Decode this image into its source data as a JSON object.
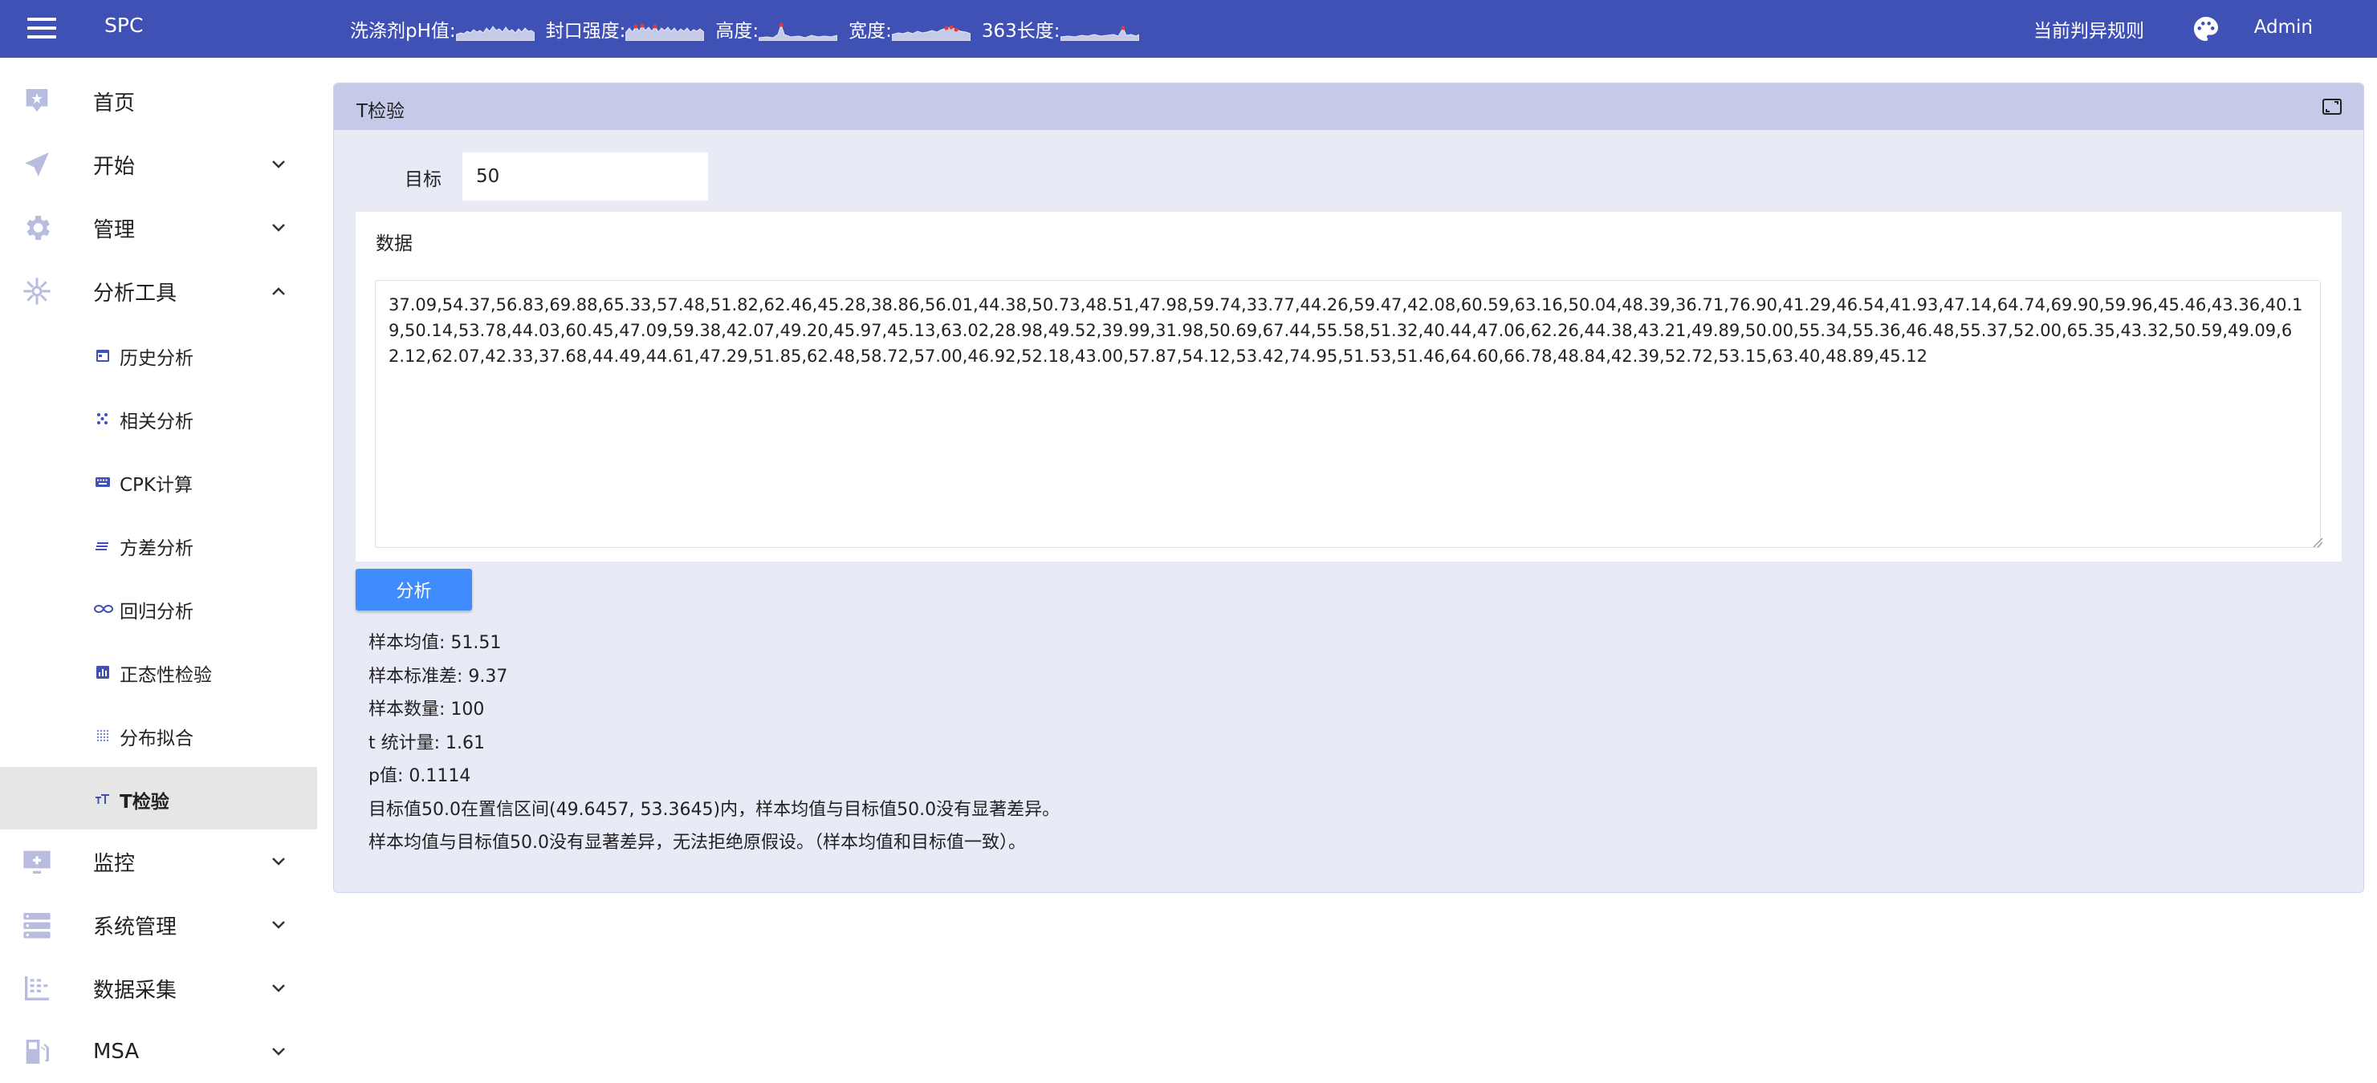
{
  "topbar": {
    "app_title": "SPC",
    "sparklines": [
      {
        "label": "洗涤剂pH值:"
      },
      {
        "label": "封口强度:"
      },
      {
        "label": "高度:"
      },
      {
        "label": "宽度:"
      },
      {
        "label": "363长度:"
      }
    ],
    "rule_link": "当前判异规则",
    "user": "Admin"
  },
  "sidebar": {
    "items": [
      {
        "label": "首页",
        "icon": "home-icon"
      },
      {
        "label": "开始",
        "icon": "send-icon"
      },
      {
        "label": "管理",
        "icon": "gear-icon"
      },
      {
        "label": "分析工具",
        "icon": "analysis-icon"
      },
      {
        "label": "监控",
        "icon": "monitor-icon"
      },
      {
        "label": "系统管理",
        "icon": "server-icon"
      },
      {
        "label": "数据采集",
        "icon": "data-collect-icon"
      },
      {
        "label": "MSA",
        "icon": "fuel-icon"
      }
    ],
    "sub_items": [
      {
        "label": "历史分析",
        "icon": "calendar-icon"
      },
      {
        "label": "相关分析",
        "icon": "scatter-icon"
      },
      {
        "label": "CPK计算",
        "icon": "keyboard-icon"
      },
      {
        "label": "方差分析",
        "icon": "lines-icon"
      },
      {
        "label": "回归分析",
        "icon": "infinity-icon"
      },
      {
        "label": "正态性检验",
        "icon": "bar-chart-icon"
      },
      {
        "label": "分布拟合",
        "icon": "grid-dots-icon"
      },
      {
        "label": "T检验",
        "icon": "text-size-icon"
      }
    ],
    "active_sub_item": "T检验"
  },
  "panel": {
    "title": "T检验",
    "target_label": "目标",
    "target_value": "50",
    "data_label": "数据",
    "data_text": "37.09,54.37,56.83,69.88,65.33,57.48,51.82,62.46,45.28,38.86,56.01,44.38,50.73,48.51,47.98,59.74,33.77,44.26,59.47,42.08,60.59,63.16,50.04,48.39,36.71,76.90,41.29,46.54,41.93,47.14,64.74,69.90,59.96,45.46,43.36,40.19,50.14,53.78,44.03,60.45,47.09,59.38,42.07,49.20,45.97,45.13,63.02,28.98,49.52,39.99,31.98,50.69,67.44,55.58,51.32,40.44,47.06,62.26,44.38,43.21,49.89,50.00,55.34,55.36,46.48,55.37,52.00,65.35,43.32,50.59,49.09,62.12,62.07,42.33,37.68,44.49,44.61,47.29,51.85,62.48,58.72,57.00,46.92,52.18,43.00,57.87,54.12,53.42,74.95,51.53,51.46,64.60,66.78,48.84,42.39,52.72,53.15,63.40,48.89,45.12",
    "analyze_button": "分析",
    "results": [
      "样本均值: 51.51",
      "样本标准差: 9.37",
      "样本数量: 100",
      "t 统计量: 1.61",
      "p值: 0.1114",
      "目标值50.0在置信区间(49.6457, 53.3645)内，样本均值与目标值50.0没有显著差异。",
      "样本均值与目标值50.0没有显著差异，无法拒绝原假设。（样本均值和目标值一致）。"
    ]
  },
  "colors": {
    "topbar": "#3f51b5",
    "panel_bg": "#e8eaf6",
    "panel_header": "#c5cae9",
    "button": "#3f8cff",
    "sidebar_icon": "#b8bde0",
    "spark_alarm": "#e53935"
  }
}
